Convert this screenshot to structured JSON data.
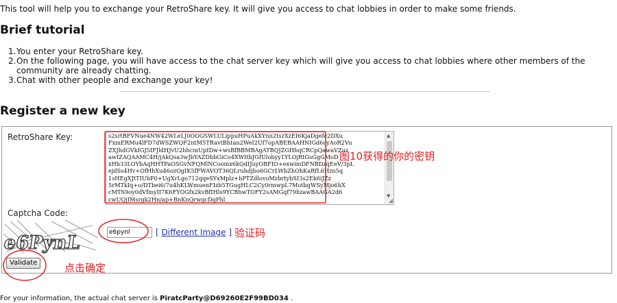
{
  "intro": "This tool will help you to exchange your RetroShare key. It will give you access to chat lobbies in order to make some friends.",
  "tutorial": {
    "title": "Brief tutorial",
    "steps": [
      "You enter your RetroShare key.",
      "On the following page, you will have access to the chat server key which will give you access to chat lobbies where other members of the community are already chatting.",
      "Chat with other people and exchange your key!"
    ]
  },
  "register": {
    "title": "Register a new key",
    "key_label": "RetroShare Key:",
    "key_value": "s2srtBFVNue4NW42WLeLJ0OOGSWLULippuHPuAkXYnn2tszXzEI6KjaDgefc2DXu\nFxmERMu4lFD7dWSZWQF2ntM5TRavtBhtan2WeI2Uf7opABEBAAHNIGd6cyAoR2Vu\nZXJhdGVkIGJ5IFJldHJvU2hhcmUpIDw+wsBfBBMBAgATBQJZGHhqCRCpQawaVZuz\nawIZAQAAMC4H/jAkQsa3wJbYAZDbbGiCo4XWttbJGfUlobyy1YLOjRtGsGgGMoD\nxHh33LOYbAqHHTPaOSGvNFQMlNCoomx6kQdIJuyOBFIO+exwimDFNBDzqEeV/3pL\nejdSs4Hv+OfHhXu46ozOgIK5fFWAVOT36QLruhdjbo6GCrLWbZhOhKaRfL6Hzn5q\n1sHEgXJtTIUhP0+UgXrLgo712qqeSYxMplz+hPTZdlovoMzbrtybSI3s2Ek6iJZz\n5rMTkIq+o/DTbei6/7u4hKLWmuenFIzb5TGugHLC2Cy0rmwpL7MotbgWSyMjo6hX\ncMTS9oy0dVfmyII7K6FYOGfx2kvBfIHls9YCBhwTOFY2sAMGqf79hzawBAAGA2d6\ncwUQjIMsrgk2Hn/ap+BnKnQrwgcDgPhl",
    "captcha_label": "Captcha Code:",
    "captcha_text": "e6PynL",
    "captcha_input": "e6pynl",
    "different_image_link": "Different Image",
    "bracket_open": "[",
    "bracket_close": "]",
    "validate_button": "Validate"
  },
  "annotations": {
    "key_note": "图10获得的你的密钥",
    "captcha_note": "验证码",
    "validate_note": "点击确定"
  },
  "footer": {
    "text": "For your information, the actual chat server is ",
    "server": "PiratcParty@D69260E2F99BD034",
    "end": " ."
  },
  "colors": {
    "annotation": "#e02020",
    "link": "#2233aa"
  }
}
